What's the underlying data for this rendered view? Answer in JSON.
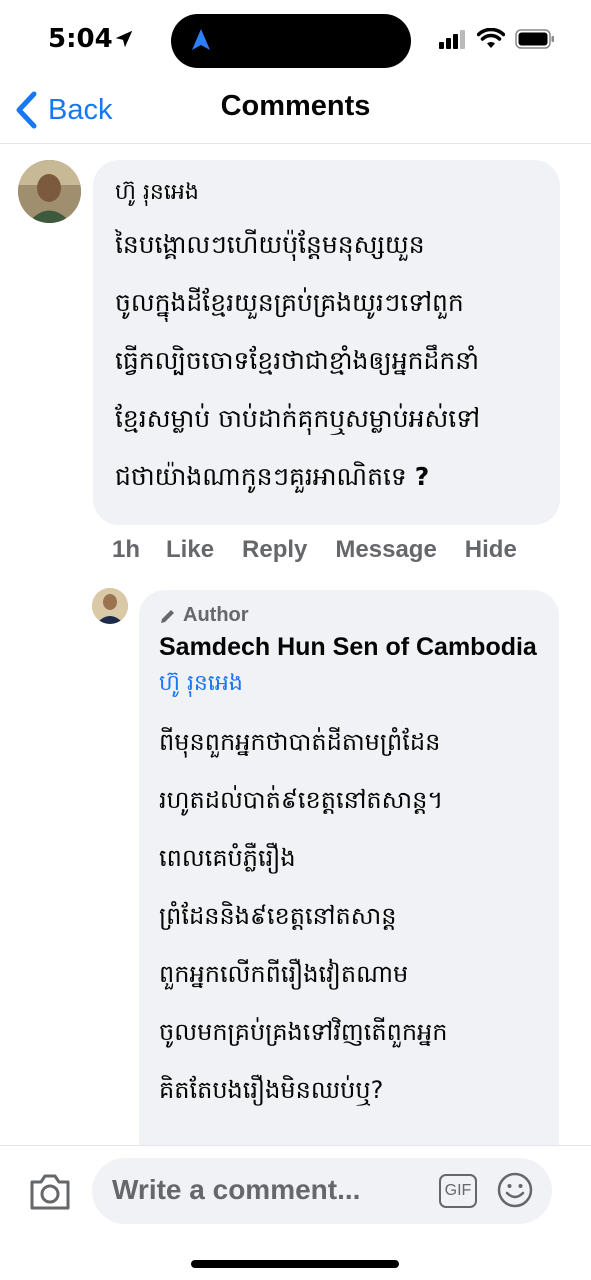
{
  "status_bar": {
    "time": "5:04"
  },
  "nav": {
    "back_label": "Back",
    "title": "Comments"
  },
  "comment": {
    "author": "ហ៊ូ រុនអេង",
    "lines": [
      "នៃបង្គោលៗហើយប៉ុន្តែមនុស្សយួន",
      "ចូលក្នុងដីខ្មែរយួនគ្រប់គ្រងយូរៗទៅពួក",
      "ធ្វើកល្បិចចោទខ្មែរថាជាខ្មាំងឲ្យអ្នកដឹកនាំ",
      "ខ្មែរសម្លាប់ ចាប់ដាក់គុកឬសម្លាប់អស់ទៅ",
      "ជថាយ៉ាងណាកូនៗគួរអាណិតទេ"
    ],
    "end_mark": "?",
    "time": "1h",
    "actions": {
      "like": "Like",
      "reply": "Reply",
      "message": "Message",
      "hide": "Hide"
    }
  },
  "reply": {
    "badge": "Author",
    "author": "Samdech Hun Sen of Cambodia",
    "mention": "ហ៊ូ រុនអេង",
    "lines": [
      "ពីមុនពួកអ្នកថាបាត់ដីតាមព្រំដែន",
      "រហូតដល់បាត់៩ខេត្តនៅតសាន្ត។",
      "ពេលគេបំភ្លឺរឿង",
      "ព្រំដែននិង៩ខេត្តនៅតសាន្ត",
      "ពួកអ្នកលើកពីរឿងវៀតណាម",
      "ចូលមកគ្រប់គ្រងទៅវិញតើពួកអ្នក",
      "គិតតែបងរឿងមិនឈប់ឬ?"
    ]
  },
  "composer": {
    "placeholder": "Write a comment...",
    "gif_label": "GIF"
  },
  "colors": {
    "accent": "#1877f2",
    "bubble": "#f0f2f5",
    "muted": "#65676b"
  },
  "icons": [
    "location-arrow-icon",
    "cellular-icon",
    "wifi-icon",
    "battery-icon",
    "chevron-left-icon",
    "pencil-icon",
    "camera-icon",
    "gif-icon",
    "emoji-icon"
  ]
}
